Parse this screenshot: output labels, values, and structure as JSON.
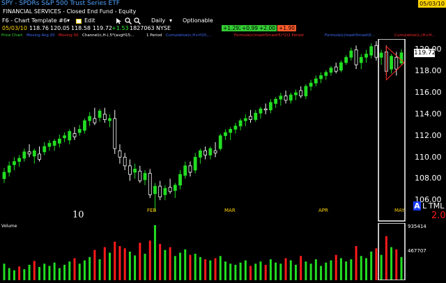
{
  "window": {
    "title": "SPY - SPDRs S&P 500 Trust Series ETF",
    "date_badge": "05/03/10",
    "subtitle": "FINANCIAL SERVICES - Closed End Fund - Equity"
  },
  "toolbar": {
    "template": "F6 - Chart Template #6",
    "edit_label": "Edit",
    "period": "Daily",
    "optionable_label": "Optionable"
  },
  "quote": {
    "date": "05/03/10",
    "open": "118.76",
    "high": "120.05",
    "low": "118.58",
    "last": "119.72",
    "change": "+1.53",
    "volume": "1827063",
    "exchange": "NYSE",
    "chips": [
      {
        "text": "+1.292",
        "color": "#33cc33"
      },
      {
        "text": "+0.99",
        "color": "#33cc33"
      },
      {
        "text": "+2.00",
        "color": "#33cc33"
      },
      {
        "text": "+1.90",
        "color": "#ff5a2a"
      }
    ]
  },
  "studies": [
    {
      "text": "Price Chart",
      "color": "#33dd33"
    },
    {
      "text": "Moving Avg 20",
      "color": "#3f6fff"
    },
    {
      "text": "Moving 50",
      "color": "#ff2a2a"
    },
    {
      "text": "Channel(c,H-(.5*(avgH15...",
      "color": "#ffffff"
    },
    {
      "text": "1 Period",
      "color": "#ffffff"
    },
    {
      "text": "Cumulative(c,H+H15,...",
      "color": "#3f6fff"
    },
    {
      "text": "Formula(c(mash5mash5)*2)2 Period",
      "color": "#ff2a2a"
    },
    {
      "text": "Formula(c(mash5mash5...",
      "color": "#3f6fff"
    },
    {
      "text": "Cumulative(c,(H+H...",
      "color": "#ff2a2a"
    }
  ],
  "price_scale": {
    "ticks": [
      "120.00",
      "118.00",
      "116.00",
      "114.00",
      "112.00",
      "110.00",
      "108.00",
      "106.00"
    ],
    "last_price": "119.72",
    "corner_labels": [
      "A",
      "L",
      "TML"
    ],
    "corner_value": "2.0"
  },
  "time_axis": {
    "year_label": "10",
    "months": [
      "FEB",
      "MAR",
      "APR",
      "MAY"
    ]
  },
  "volume_pane": {
    "label": "Volume",
    "ticks": [
      "935414",
      "467707"
    ]
  },
  "colors": {
    "up": "#22dd22",
    "down": "#ff1a1a",
    "neutral": "#ffffff",
    "highlight_box": "#ffffff"
  },
  "chart_data": {
    "type": "candlestick",
    "title": "SPY - SPDRs S&P 500 Trust Series ETF",
    "period": "Daily",
    "ylim": [
      104,
      121
    ],
    "y_ticks": [
      106,
      108,
      110,
      112,
      114,
      116,
      118,
      120
    ],
    "months": [
      "FEB",
      "MAR",
      "APR",
      "MAY"
    ],
    "candles": [
      {
        "o": 108.0,
        "h": 109.0,
        "l": 107.6,
        "c": 108.6
      },
      {
        "o": 108.6,
        "h": 109.6,
        "l": 108.2,
        "c": 109.2
      },
      {
        "o": 109.3,
        "h": 110.0,
        "l": 108.8,
        "c": 109.6
      },
      {
        "o": 109.6,
        "h": 110.2,
        "l": 109.1,
        "c": 109.9
      },
      {
        "o": 109.9,
        "h": 110.8,
        "l": 109.6,
        "c": 110.5
      },
      {
        "o": 110.5,
        "h": 111.2,
        "l": 110.0,
        "c": 110.3
      },
      {
        "o": 110.1,
        "h": 110.8,
        "l": 109.4,
        "c": 110.6
      },
      {
        "o": 110.3,
        "h": 111.0,
        "l": 109.6,
        "c": 109.8
      },
      {
        "o": 110.5,
        "h": 111.4,
        "l": 110.2,
        "c": 111.0
      },
      {
        "o": 111.0,
        "h": 111.6,
        "l": 110.6,
        "c": 111.3
      },
      {
        "o": 111.1,
        "h": 111.7,
        "l": 110.6,
        "c": 111.5
      },
      {
        "o": 111.3,
        "h": 112.1,
        "l": 110.9,
        "c": 111.7
      },
      {
        "o": 111.8,
        "h": 112.3,
        "l": 111.4,
        "c": 112.0
      },
      {
        "o": 111.6,
        "h": 112.6,
        "l": 111.2,
        "c": 112.4
      },
      {
        "o": 112.2,
        "h": 112.8,
        "l": 111.6,
        "c": 111.9
      },
      {
        "o": 112.3,
        "h": 113.0,
        "l": 112.0,
        "c": 112.6
      },
      {
        "o": 112.5,
        "h": 113.6,
        "l": 112.2,
        "c": 113.4
      },
      {
        "o": 113.4,
        "h": 114.2,
        "l": 112.9,
        "c": 113.8
      },
      {
        "o": 113.6,
        "h": 114.6,
        "l": 113.0,
        "c": 113.2
      },
      {
        "o": 113.7,
        "h": 114.5,
        "l": 113.3,
        "c": 114.3
      },
      {
        "o": 114.0,
        "h": 114.6,
        "l": 113.2,
        "c": 113.5
      },
      {
        "o": 113.4,
        "h": 114.0,
        "l": 112.8,
        "c": 113.6
      },
      {
        "o": 113.6,
        "h": 114.4,
        "l": 110.3,
        "c": 110.8
      },
      {
        "o": 110.6,
        "h": 111.2,
        "l": 109.4,
        "c": 110.0
      },
      {
        "o": 110.0,
        "h": 110.4,
        "l": 108.8,
        "c": 109.2
      },
      {
        "o": 109.2,
        "h": 109.8,
        "l": 107.8,
        "c": 108.4
      },
      {
        "o": 108.6,
        "h": 109.4,
        "l": 108.0,
        "c": 108.9
      },
      {
        "o": 108.7,
        "h": 109.2,
        "l": 107.6,
        "c": 107.8
      },
      {
        "o": 107.9,
        "h": 108.8,
        "l": 107.4,
        "c": 108.5
      },
      {
        "o": 108.5,
        "h": 108.9,
        "l": 106.2,
        "c": 106.5
      },
      {
        "o": 106.6,
        "h": 107.6,
        "l": 105.0,
        "c": 107.3
      },
      {
        "o": 107.3,
        "h": 107.8,
        "l": 106.0,
        "c": 106.3
      },
      {
        "o": 106.5,
        "h": 107.4,
        "l": 106.0,
        "c": 107.1
      },
      {
        "o": 107.2,
        "h": 108.0,
        "l": 106.6,
        "c": 106.8
      },
      {
        "o": 106.9,
        "h": 107.6,
        "l": 106.2,
        "c": 107.4
      },
      {
        "o": 107.4,
        "h": 108.8,
        "l": 107.0,
        "c": 108.4
      },
      {
        "o": 108.3,
        "h": 109.6,
        "l": 108.0,
        "c": 109.2
      },
      {
        "o": 109.2,
        "h": 109.6,
        "l": 108.2,
        "c": 108.6
      },
      {
        "o": 108.8,
        "h": 110.4,
        "l": 108.5,
        "c": 110.0
      },
      {
        "o": 110.0,
        "h": 110.8,
        "l": 109.4,
        "c": 110.6
      },
      {
        "o": 110.6,
        "h": 111.0,
        "l": 109.8,
        "c": 110.2
      },
      {
        "o": 110.2,
        "h": 111.0,
        "l": 109.8,
        "c": 110.8
      },
      {
        "o": 110.6,
        "h": 111.4,
        "l": 110.0,
        "c": 110.4
      },
      {
        "o": 110.8,
        "h": 112.2,
        "l": 110.6,
        "c": 112.0
      },
      {
        "o": 112.0,
        "h": 112.6,
        "l": 111.6,
        "c": 112.3
      },
      {
        "o": 112.3,
        "h": 112.8,
        "l": 111.6,
        "c": 112.6
      },
      {
        "o": 112.6,
        "h": 113.2,
        "l": 112.2,
        "c": 112.9
      },
      {
        "o": 112.9,
        "h": 113.6,
        "l": 112.5,
        "c": 113.4
      },
      {
        "o": 113.4,
        "h": 114.0,
        "l": 112.9,
        "c": 113.6
      },
      {
        "o": 113.8,
        "h": 114.4,
        "l": 113.2,
        "c": 113.5
      },
      {
        "o": 113.5,
        "h": 114.4,
        "l": 113.3,
        "c": 114.1
      },
      {
        "o": 114.1,
        "h": 114.7,
        "l": 113.6,
        "c": 114.5
      },
      {
        "o": 114.5,
        "h": 115.0,
        "l": 114.0,
        "c": 114.4
      },
      {
        "o": 114.4,
        "h": 115.4,
        "l": 114.1,
        "c": 115.1
      },
      {
        "o": 115.0,
        "h": 115.6,
        "l": 114.6,
        "c": 115.4
      },
      {
        "o": 115.4,
        "h": 116.0,
        "l": 114.8,
        "c": 115.7
      },
      {
        "o": 115.7,
        "h": 116.2,
        "l": 115.0,
        "c": 115.3
      },
      {
        "o": 115.3,
        "h": 116.0,
        "l": 115.0,
        "c": 115.8
      },
      {
        "o": 115.8,
        "h": 116.3,
        "l": 115.3,
        "c": 116.0
      },
      {
        "o": 116.2,
        "h": 116.6,
        "l": 115.5,
        "c": 115.7
      },
      {
        "o": 115.7,
        "h": 116.8,
        "l": 115.4,
        "c": 116.6
      },
      {
        "o": 116.6,
        "h": 117.2,
        "l": 116.2,
        "c": 116.9
      },
      {
        "o": 116.9,
        "h": 117.6,
        "l": 116.6,
        "c": 117.3
      },
      {
        "o": 117.3,
        "h": 117.9,
        "l": 116.9,
        "c": 117.6
      },
      {
        "o": 117.6,
        "h": 118.1,
        "l": 117.2,
        "c": 117.9
      },
      {
        "o": 117.9,
        "h": 118.5,
        "l": 117.6,
        "c": 118.3
      },
      {
        "o": 118.4,
        "h": 118.8,
        "l": 117.8,
        "c": 118.0
      },
      {
        "o": 118.1,
        "h": 119.0,
        "l": 117.9,
        "c": 118.8
      },
      {
        "o": 118.8,
        "h": 119.5,
        "l": 118.6,
        "c": 119.3
      },
      {
        "o": 119.3,
        "h": 120.2,
        "l": 119.0,
        "c": 119.9
      },
      {
        "o": 120.0,
        "h": 120.4,
        "l": 118.2,
        "c": 118.6
      },
      {
        "o": 118.8,
        "h": 119.6,
        "l": 118.2,
        "c": 119.3
      },
      {
        "o": 119.3,
        "h": 120.0,
        "l": 118.8,
        "c": 119.6
      },
      {
        "o": 119.5,
        "h": 120.6,
        "l": 119.2,
        "c": 120.3
      },
      {
        "o": 120.4,
        "h": 120.8,
        "l": 119.0,
        "c": 119.3
      },
      {
        "o": 119.3,
        "h": 120.0,
        "l": 118.6,
        "c": 119.7
      },
      {
        "o": 119.8,
        "h": 120.4,
        "l": 117.6,
        "c": 118.0
      },
      {
        "o": 118.2,
        "h": 119.6,
        "l": 117.8,
        "c": 119.4
      },
      {
        "o": 119.3,
        "h": 119.8,
        "l": 117.6,
        "c": 118.2
      },
      {
        "o": 118.76,
        "h": 120.05,
        "l": 118.58,
        "c": 119.72
      }
    ],
    "volume": [
      {
        "v": 0.3,
        "up": true
      },
      {
        "v": 0.22,
        "up": true
      },
      {
        "v": 0.18,
        "up": true
      },
      {
        "v": 0.25,
        "up": false
      },
      {
        "v": 0.2,
        "up": true
      },
      {
        "v": 0.28,
        "up": true
      },
      {
        "v": 0.35,
        "up": false
      },
      {
        "v": 0.24,
        "up": true
      },
      {
        "v": 0.3,
        "up": true
      },
      {
        "v": 0.26,
        "up": true
      },
      {
        "v": 0.32,
        "up": true
      },
      {
        "v": 0.22,
        "up": true
      },
      {
        "v": 0.28,
        "up": true
      },
      {
        "v": 0.34,
        "up": true
      },
      {
        "v": 0.4,
        "up": false
      },
      {
        "v": 0.3,
        "up": true
      },
      {
        "v": 0.36,
        "up": true
      },
      {
        "v": 0.42,
        "up": true
      },
      {
        "v": 0.55,
        "up": false
      },
      {
        "v": 0.38,
        "up": true
      },
      {
        "v": 0.6,
        "up": false
      },
      {
        "v": 0.5,
        "up": true
      },
      {
        "v": 0.7,
        "up": false
      },
      {
        "v": 0.62,
        "up": false
      },
      {
        "v": 0.58,
        "up": false
      },
      {
        "v": 0.52,
        "up": true
      },
      {
        "v": 0.45,
        "up": true
      },
      {
        "v": 0.68,
        "up": false
      },
      {
        "v": 0.48,
        "up": true
      },
      {
        "v": 0.72,
        "up": false
      },
      {
        "v": 1.0,
        "up": true
      },
      {
        "v": 0.66,
        "up": false
      },
      {
        "v": 0.55,
        "up": true
      },
      {
        "v": 0.6,
        "up": false
      },
      {
        "v": 0.44,
        "up": true
      },
      {
        "v": 0.5,
        "up": true
      },
      {
        "v": 0.56,
        "up": true
      },
      {
        "v": 0.46,
        "up": false
      },
      {
        "v": 0.48,
        "up": true
      },
      {
        "v": 0.42,
        "up": true
      },
      {
        "v": 0.38,
        "up": false
      },
      {
        "v": 0.36,
        "up": true
      },
      {
        "v": 0.4,
        "up": false
      },
      {
        "v": 0.44,
        "up": true
      },
      {
        "v": 0.34,
        "up": true
      },
      {
        "v": 0.3,
        "up": true
      },
      {
        "v": 0.28,
        "up": true
      },
      {
        "v": 0.32,
        "up": true
      },
      {
        "v": 0.36,
        "up": true
      },
      {
        "v": 0.26,
        "up": false
      },
      {
        "v": 0.3,
        "up": true
      },
      {
        "v": 0.34,
        "up": true
      },
      {
        "v": 0.28,
        "up": false
      },
      {
        "v": 0.38,
        "up": true
      },
      {
        "v": 0.32,
        "up": true
      },
      {
        "v": 0.3,
        "up": true
      },
      {
        "v": 0.4,
        "up": false
      },
      {
        "v": 0.36,
        "up": true
      },
      {
        "v": 0.28,
        "up": true
      },
      {
        "v": 0.44,
        "up": false
      },
      {
        "v": 0.34,
        "up": true
      },
      {
        "v": 0.3,
        "up": true
      },
      {
        "v": 0.38,
        "up": true
      },
      {
        "v": 0.26,
        "up": true
      },
      {
        "v": 0.32,
        "up": true
      },
      {
        "v": 0.36,
        "up": true
      },
      {
        "v": 0.46,
        "up": false
      },
      {
        "v": 0.4,
        "up": true
      },
      {
        "v": 0.34,
        "up": true
      },
      {
        "v": 0.38,
        "up": true
      },
      {
        "v": 0.62,
        "up": false
      },
      {
        "v": 0.44,
        "up": true
      },
      {
        "v": 0.4,
        "up": true
      },
      {
        "v": 0.52,
        "up": true
      },
      {
        "v": 0.58,
        "up": false
      },
      {
        "v": 0.46,
        "up": true
      },
      {
        "v": 0.8,
        "up": false
      },
      {
        "v": 0.6,
        "up": true
      },
      {
        "v": 0.56,
        "up": false
      },
      {
        "v": 0.42,
        "up": true
      }
    ]
  }
}
